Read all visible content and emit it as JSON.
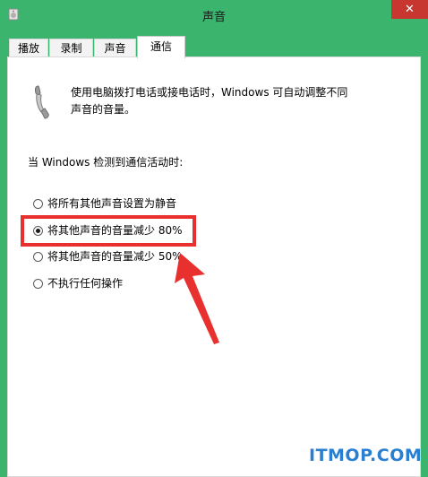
{
  "window": {
    "title": "声音",
    "close_label": "✕"
  },
  "tabs": [
    {
      "label": "播放",
      "active": false
    },
    {
      "label": "录制",
      "active": false
    },
    {
      "label": "声音",
      "active": false
    },
    {
      "label": "通信",
      "active": true
    }
  ],
  "communications": {
    "description_line1": "使用电脑拨打电话或接电话时，Windows 可自动调整不同",
    "description_line2": "声音的音量。",
    "group_label": "当 Windows 检测到通信活动时:",
    "options": [
      {
        "label": "将所有其他声音设置为静音",
        "checked": false
      },
      {
        "label": "将其他声音的音量减少 80%",
        "checked": true
      },
      {
        "label": "将其他声音的音量减少 50%",
        "checked": false
      },
      {
        "label": "不执行任何操作",
        "checked": false
      }
    ]
  },
  "watermark": "ITMOP.COM",
  "colors": {
    "frame": "#3bb56d",
    "close": "#c7372f",
    "annotation": "#e8312e",
    "watermark": "#2a7fd0"
  },
  "icons": {
    "app": "speaker-icon",
    "phone": "telephone-icon"
  }
}
